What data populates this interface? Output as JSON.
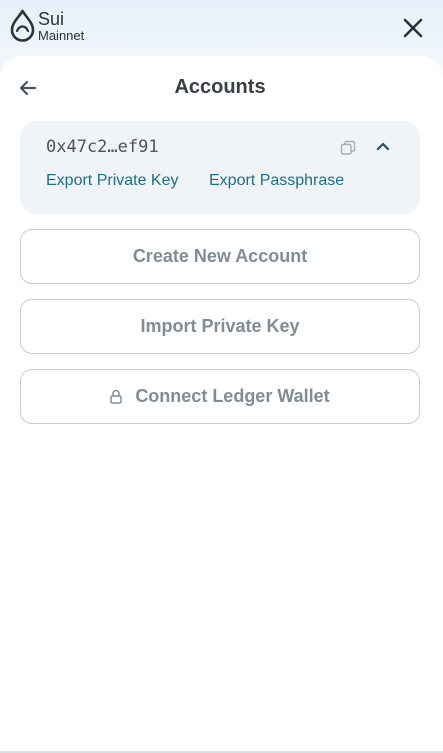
{
  "brand": {
    "name": "Sui",
    "network": "Mainnet"
  },
  "page": {
    "title": "Accounts"
  },
  "account": {
    "address": "0x47c2…ef91",
    "export_private_key": "Export Private Key",
    "export_passphrase": "Export Passphrase"
  },
  "actions": {
    "create": "Create New Account",
    "import": "Import Private Key",
    "ledger": "Connect Ledger Wallet"
  },
  "icons": [
    "sui-logo-icon",
    "close-icon",
    "back-arrow-icon",
    "copy-icon",
    "chevron-up-icon",
    "lock-icon"
  ],
  "colors": {
    "link": "#1d6f8c",
    "button_text": "#808c96",
    "card_bg": "#f0f4f7"
  }
}
